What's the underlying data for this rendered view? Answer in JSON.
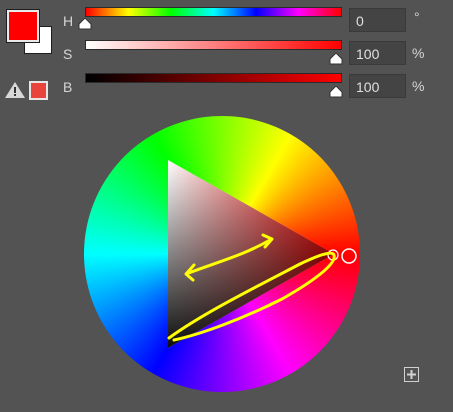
{
  "swatches": {
    "foreground_color": "#ff0000",
    "background_color": "#ffffff",
    "gamut_warning_icon": "warning-triangle-icon",
    "gamut_color": "#e8443c"
  },
  "sliders": {
    "hue": {
      "label": "H",
      "value": "0",
      "unit": "°",
      "position": 0.0
    },
    "saturation": {
      "label": "S",
      "value": "100",
      "unit": "%",
      "position": 1.0
    },
    "brightness": {
      "label": "B",
      "value": "100",
      "unit": "%",
      "position": 1.0
    }
  },
  "wheel": {
    "hue_deg": 0,
    "selected_color": "#ff0000",
    "annotation_color": "#ffff00"
  },
  "buttons": {
    "expand_icon": "plus-square-icon"
  }
}
